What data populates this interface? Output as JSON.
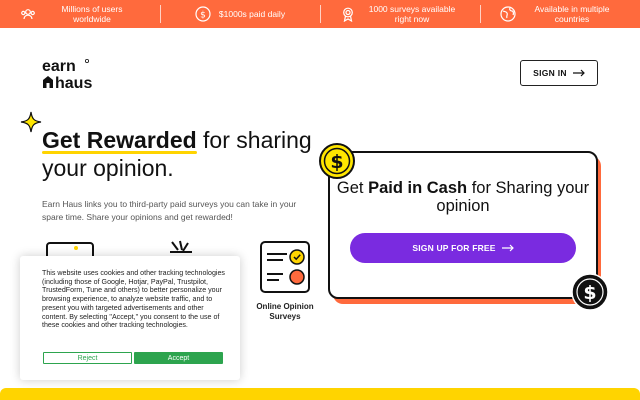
{
  "topbar": {
    "items": [
      {
        "icon": "users-icon",
        "text": "Millions of users worldwide"
      },
      {
        "icon": "dollar-coin-icon",
        "text": "$1000s paid daily"
      },
      {
        "icon": "award-badge-icon",
        "text": "1000 surveys available right now"
      },
      {
        "icon": "globe-icon",
        "text": "Available in multiple countries"
      }
    ]
  },
  "header": {
    "logo_line1": "earn",
    "logo_line2": "haus",
    "signin_label": "SIGN IN"
  },
  "hero": {
    "headline_bold": "Get Rewarded",
    "headline_rest": " for sharing your opinion.",
    "description": "Earn Haus links you to third-party paid surveys you can take in your spare time. Share your opinions and get rewarded!"
  },
  "features": [
    {
      "icon": "laptop-icon",
      "label": ""
    },
    {
      "icon": "tools-icon",
      "label": ""
    },
    {
      "icon": "survey-checklist-icon",
      "label": "Online Opinion Surveys"
    }
  ],
  "card": {
    "title_pre": "Get ",
    "title_bold": "Paid in Cash",
    "title_post": " for Sharing your opinion",
    "cta_label": "SIGN UP FOR FREE"
  },
  "cookie": {
    "text": "This website uses cookies and other tracking technologies (including those of Google, Hotjar, PayPal, Trustpilot, TrustedForm, Tune and others) to better personalize your browsing experience, to analyze website traffic, and to present you with targeted advertisements and other content. By selecting \"Accept,\" you consent to the use of these cookies and other tracking technologies.",
    "reject_label": "Reject",
    "accept_label": "Accept"
  },
  "colors": {
    "topbar": "#ff6a3d",
    "cta": "#7a2be0",
    "accent_yellow": "#ffd400",
    "accept_green": "#2da44e"
  }
}
